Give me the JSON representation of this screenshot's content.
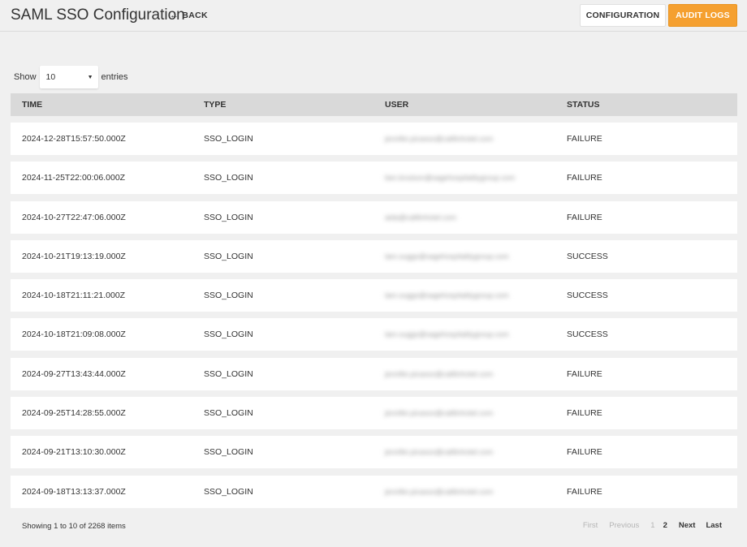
{
  "header": {
    "title": "SAML SSO Configuration",
    "back_label": "BACK",
    "config_label": "CONFIGURATION",
    "audit_label": "AUDIT LOGS"
  },
  "length": {
    "show_label": "Show",
    "value": "10",
    "entries_label": "entries"
  },
  "table": {
    "columns": [
      "TIME",
      "TYPE",
      "USER",
      "STATUS"
    ],
    "rows": [
      {
        "time": "2024-12-28T15:57:50.000Z",
        "type": "SSO_LOGIN",
        "user": "jennifer.picasso@caltlinhotel.com",
        "status": "FAILURE"
      },
      {
        "time": "2024-11-25T22:00:06.000Z",
        "type": "SSO_LOGIN",
        "user": "ben.knutson@sagehospitalitygroup.com",
        "status": "FAILURE"
      },
      {
        "time": "2024-10-27T22:47:06.000Z",
        "type": "SSO_LOGIN",
        "user": "aida@caltlinhotel.com",
        "status": "FAILURE"
      },
      {
        "time": "2024-10-21T19:13:19.000Z",
        "type": "SSO_LOGIN",
        "user": "tam.suggs@sagehospitalitygroup.com",
        "status": "SUCCESS"
      },
      {
        "time": "2024-10-18T21:11:21.000Z",
        "type": "SSO_LOGIN",
        "user": "tam.suggs@sagehospitalitygroup.com",
        "status": "SUCCESS"
      },
      {
        "time": "2024-10-18T21:09:08.000Z",
        "type": "SSO_LOGIN",
        "user": "tam.suggs@sagehospitalitygroup.com",
        "status": "SUCCESS"
      },
      {
        "time": "2024-09-27T13:43:44.000Z",
        "type": "SSO_LOGIN",
        "user": "jennifer.picasso@caltlinhotel.com",
        "status": "FAILURE"
      },
      {
        "time": "2024-09-25T14:28:55.000Z",
        "type": "SSO_LOGIN",
        "user": "jennifer.picasso@caltlinhotel.com",
        "status": "FAILURE"
      },
      {
        "time": "2024-09-21T13:10:30.000Z",
        "type": "SSO_LOGIN",
        "user": "jennifer.picasso@caltlinhotel.com",
        "status": "FAILURE"
      },
      {
        "time": "2024-09-18T13:13:37.000Z",
        "type": "SSO_LOGIN",
        "user": "jennifer.picasso@caltlinhotel.com",
        "status": "FAILURE"
      }
    ]
  },
  "footer": {
    "info": "Showing 1 to 10 of 2268 items",
    "pagination": {
      "first": "First",
      "previous": "Previous",
      "page1": "1",
      "page2": "2",
      "next": "Next",
      "last": "Last"
    }
  },
  "colors": {
    "accent": "#f5a030",
    "background": "#f0f0f0",
    "header_row": "#d9d9d9"
  }
}
